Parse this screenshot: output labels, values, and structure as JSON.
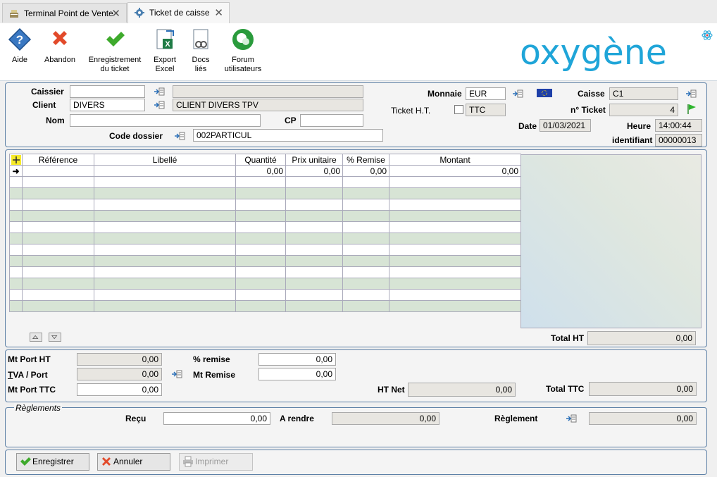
{
  "tabs": [
    {
      "label": "Terminal Point de Vente",
      "icon": "register-icon"
    },
    {
      "label": "Ticket de caisse",
      "icon": "gear-icon"
    }
  ],
  "toolbar": {
    "aide": "Aide",
    "abandon": "Abandon",
    "enregistrement_1": "Enregistrement",
    "enregistrement_2": "du ticket",
    "export_1": "Export",
    "export_2": "Excel",
    "docs_1": "Docs",
    "docs_2": "liés",
    "forum_1": "Forum",
    "forum_2": "utilisateurs"
  },
  "logo": "oxygène",
  "header": {
    "caissier_label": "Caissier",
    "caissier_value": "",
    "caissier_name": "",
    "client_label": "Client",
    "client_value": "DIVERS",
    "client_name": "CLIENT DIVERS TPV",
    "nom_label": "Nom",
    "nom_value": "",
    "cp_label": "CP",
    "cp_value": "",
    "code_dossier_label": "Code dossier",
    "code_dossier_value": "002PARTICUL",
    "monnaie_label": "Monnaie",
    "monnaie_value": "EUR",
    "ticket_ht_label": "Ticket H.T.",
    "ttc_value": "TTC",
    "caisse_label": "Caisse",
    "caisse_value": "C1",
    "no_ticket_label": "n° Ticket",
    "no_ticket_value": "4",
    "date_label": "Date",
    "date_value": "01/03/2021",
    "heure_label": "Heure",
    "heure_value": "14:00:44",
    "identifiant_label": "identifiant",
    "identifiant_value": "00000013"
  },
  "grid": {
    "columns": [
      "Référence",
      "Libellé",
      "Quantité",
      "Prix unitaire",
      "% Remise",
      "Montant"
    ],
    "first_row": [
      "",
      "",
      "0,00",
      "0,00",
      "0,00",
      "0,00"
    ],
    "total_ht_label": "Total HT",
    "total_ht_value": "0,00"
  },
  "totals": {
    "mt_port_ht_label": "Mt Port HT",
    "mt_port_ht_value": "0,00",
    "tva_port_label": "TVA / Port",
    "tva_port_value": "0,00",
    "mt_port_ttc_label": "Mt Port TTC",
    "mt_port_ttc_value": "0,00",
    "pct_remise_label": "% remise",
    "pct_remise_value": "0,00",
    "mt_remise_label": "Mt Remise",
    "mt_remise_value": "0,00",
    "ht_net_label": "HT Net",
    "ht_net_value": "0,00",
    "total_ttc_label": "Total TTC",
    "total_ttc_value": "0,00"
  },
  "reglements": {
    "title": "Règlements",
    "recu_label": "Reçu",
    "recu_value": "0,00",
    "a_rendre_label": "A rendre",
    "a_rendre_value": "0,00",
    "reglement_label": "Règlement",
    "reglement_value": "0,00"
  },
  "buttons": {
    "enregistrer": "Enregistrer",
    "annuler": "Annuler",
    "imprimer": "Imprimer"
  },
  "colors": {
    "accent": "#1fa5d8",
    "row_alt": "#d7e4d5",
    "panel_border": "#5d80a6"
  }
}
